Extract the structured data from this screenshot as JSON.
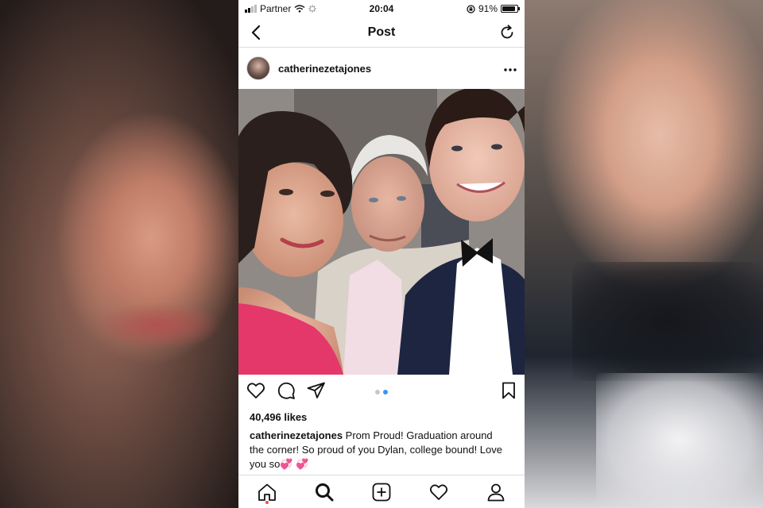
{
  "status_bar": {
    "carrier": "Partner",
    "time": "20:04",
    "battery": "91%",
    "battery_level": 0.91
  },
  "nav": {
    "title": "Post",
    "back_icon": "chevron-left-icon",
    "refresh_icon": "refresh-icon"
  },
  "post": {
    "username": "catherinezetajones",
    "more_icon": "more-horizontal-icon",
    "carousel": {
      "count": 2,
      "active_index": 1
    },
    "likes": "40,496 likes",
    "caption_user": "catherinezetajones",
    "caption_text": " Prom Proud! Graduation around the corner! So proud of you Dylan, college bound! Love you so",
    "caption_emoji": "💞 💞"
  },
  "colors": {
    "accent_blue": "#3897f0",
    "notification_red": "#ed4956",
    "border": "#dbdbdb"
  },
  "tab_bar": {
    "items": [
      "home-icon",
      "search-icon",
      "new-post-icon",
      "activity-heart-icon",
      "profile-icon"
    ],
    "active": "search-icon"
  }
}
